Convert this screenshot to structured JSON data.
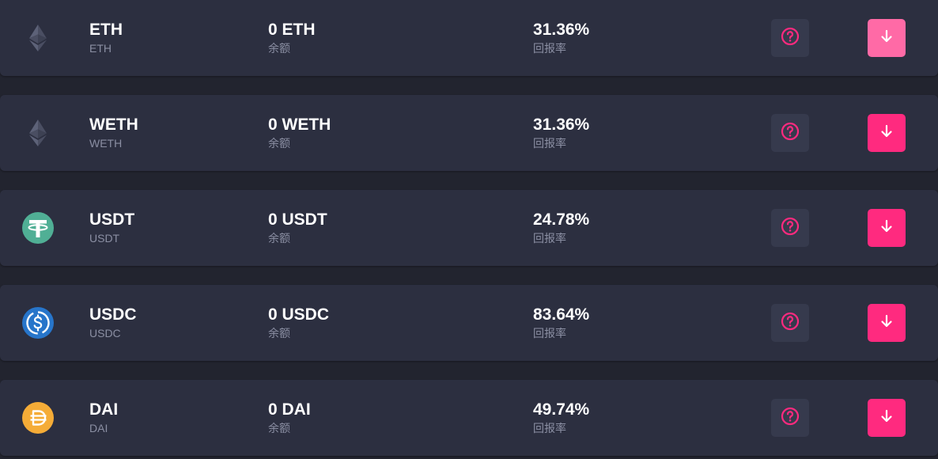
{
  "colors": {
    "background": "#22242f",
    "row": "#2c2f40",
    "accent": "#ff2a7f",
    "accent_hover": "#ff6aa6",
    "secondary_text": "#8b8fa3"
  },
  "tokens": [
    {
      "icon": "ethereum-icon",
      "symbol": "ETH",
      "subtitle": "ETH",
      "balance": "0 ETH",
      "balance_label": "余额",
      "apy": "31.36%",
      "apy_label": "回报率"
    },
    {
      "icon": "ethereum-icon",
      "symbol": "WETH",
      "subtitle": "WETH",
      "balance": "0 WETH",
      "balance_label": "余额",
      "apy": "31.36%",
      "apy_label": "回报率"
    },
    {
      "icon": "tether-icon",
      "symbol": "USDT",
      "subtitle": "USDT",
      "balance": "0 USDT",
      "balance_label": "余额",
      "apy": "24.78%",
      "apy_label": "回报率"
    },
    {
      "icon": "usdc-icon",
      "symbol": "USDC",
      "subtitle": "USDC",
      "balance": "0 USDC",
      "balance_label": "余额",
      "apy": "83.64%",
      "apy_label": "回报率"
    },
    {
      "icon": "dai-icon",
      "symbol": "DAI",
      "subtitle": "DAI",
      "balance": "0 DAI",
      "balance_label": "余额",
      "apy": "49.74%",
      "apy_label": "回报率"
    }
  ],
  "actions": {
    "help_icon": "question-circle-icon",
    "download_icon": "arrow-down-icon"
  }
}
